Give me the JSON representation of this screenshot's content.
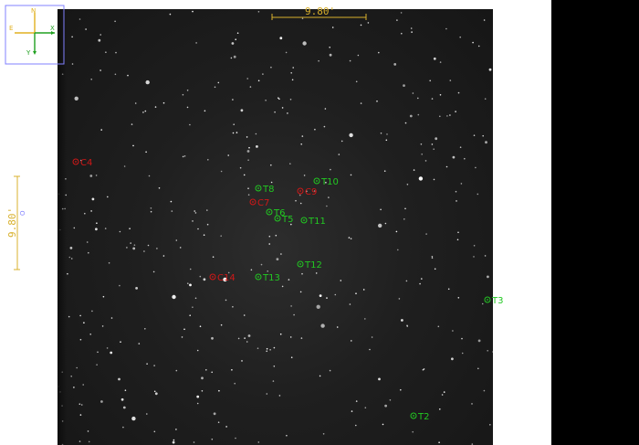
{
  "colors": {
    "accent_scale": "#d8b02c",
    "target_green": "#22c822",
    "comparison_red": "#d01818",
    "compass_box": "#8080ff",
    "compass_north": "#e0b020",
    "compass_east": "#e0b020",
    "compass_x": "#20a020",
    "compass_y": "#20a020"
  },
  "compass": {
    "north_label": "N",
    "east_label": "E",
    "x_label": "X",
    "y_label": "Y"
  },
  "scale_bars": {
    "horizontal_label": "9.80'",
    "vertical_label": "9.80'",
    "vertical_sub": "O"
  },
  "markers": [
    {
      "label": "C4",
      "kind": "comparison"
    },
    {
      "label": "T8",
      "kind": "target"
    },
    {
      "label": "T10",
      "kind": "target"
    },
    {
      "label": "C9",
      "kind": "comparison"
    },
    {
      "label": "C7",
      "kind": "comparison"
    },
    {
      "label": "T6",
      "kind": "target"
    },
    {
      "label": "T5",
      "kind": "target"
    },
    {
      "label": "T11",
      "kind": "target"
    },
    {
      "label": "T12",
      "kind": "target"
    },
    {
      "label": "C14",
      "kind": "comparison"
    },
    {
      "label": "T13",
      "kind": "target"
    },
    {
      "label": "T3",
      "kind": "target"
    },
    {
      "label": "T2",
      "kind": "target"
    }
  ]
}
